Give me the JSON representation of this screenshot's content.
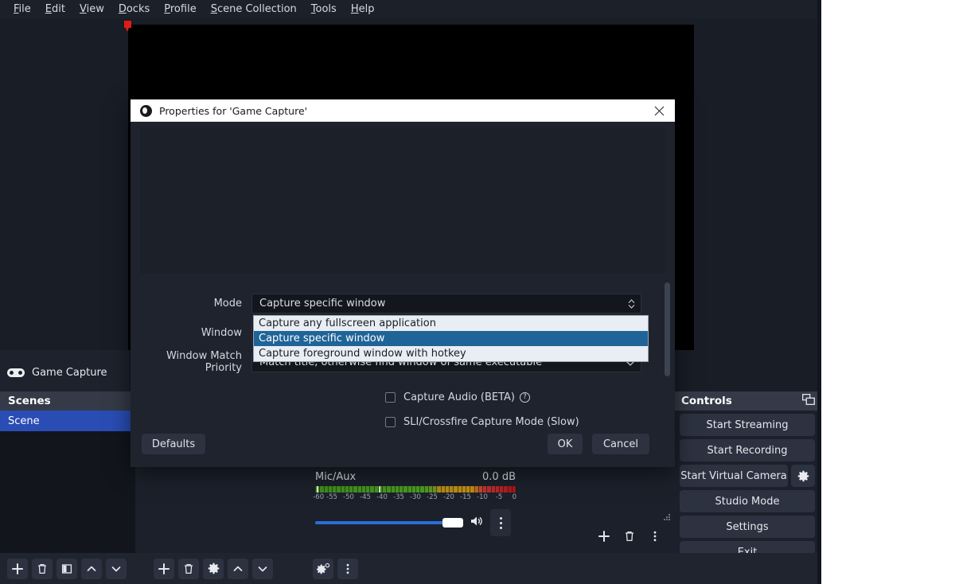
{
  "menubar": {
    "items": [
      {
        "label": "File",
        "mnemonic": "F"
      },
      {
        "label": "Edit",
        "mnemonic": "E"
      },
      {
        "label": "View",
        "mnemonic": "V"
      },
      {
        "label": "Docks",
        "mnemonic": "D"
      },
      {
        "label": "Profile",
        "mnemonic": "P"
      },
      {
        "label": "Scene Collection",
        "mnemonic": "S"
      },
      {
        "label": "Tools",
        "mnemonic": "T"
      },
      {
        "label": "Help",
        "mnemonic": "H"
      }
    ]
  },
  "sources": {
    "items": [
      {
        "label": "Game Capture",
        "icon": "gamepad-icon"
      }
    ]
  },
  "scenes": {
    "header": "Scenes",
    "items": [
      {
        "label": "Scene",
        "selected": true
      }
    ]
  },
  "mixer": {
    "channel_name": "Mic/Aux",
    "level_db": "0.0 dB",
    "scale_ticks": [
      "-60",
      "-55",
      "-50",
      "-45",
      "-40",
      "-35",
      "-30",
      "-25",
      "-20",
      "-15",
      "-10",
      "-5",
      "0"
    ]
  },
  "controls": {
    "header": "Controls",
    "buttons": [
      {
        "label": "Start Streaming"
      },
      {
        "label": "Start Recording"
      },
      {
        "label": "Start Virtual Camera"
      },
      {
        "label": "Studio Mode"
      },
      {
        "label": "Settings"
      },
      {
        "label": "Exit"
      }
    ],
    "popout_icon": "float-dock-icon",
    "vcam_settings_icon": "gear-icon"
  },
  "dialog": {
    "title": "Properties for 'Game Capture'",
    "close_icon": "close-icon",
    "fields": {
      "mode_label": "Mode",
      "mode_value": "Capture specific window",
      "window_label": "Window",
      "window_value": "",
      "priority_label": "Window Match Priority",
      "priority_value": "Match title, otherwise find window of same executable"
    },
    "checkboxes": [
      {
        "label": "Capture Audio (BETA)",
        "checked": false,
        "help": "?"
      },
      {
        "label": "SLI/Crossfire Capture Mode (Slow)",
        "checked": false
      }
    ],
    "buttons": {
      "defaults": "Defaults",
      "ok": "OK",
      "cancel": "Cancel"
    }
  },
  "dropdown": {
    "options": [
      {
        "label": "Capture any fullscreen application",
        "highlight": false
      },
      {
        "label": "Capture specific window",
        "highlight": true
      },
      {
        "label": "Capture foreground window with hotkey",
        "highlight": false
      }
    ]
  },
  "toolbars": {
    "scenes": [
      "add-icon",
      "remove-icon",
      "filter-icon",
      "move-up-icon",
      "move-down-icon"
    ],
    "sources": [
      "add-icon",
      "remove-icon",
      "properties-gear-icon",
      "move-up-icon",
      "move-down-icon"
    ],
    "mixer": [
      "advanced-audio-icon",
      "mixer-menu-icon"
    ],
    "transitions": [
      "add-icon",
      "remove-icon",
      "transition-menu-icon"
    ]
  },
  "colors": {
    "accent": "#2a4db5",
    "dock_header": "#343a47",
    "panel": "#1b202a",
    "dropdown_highlight": "#1f6497"
  }
}
